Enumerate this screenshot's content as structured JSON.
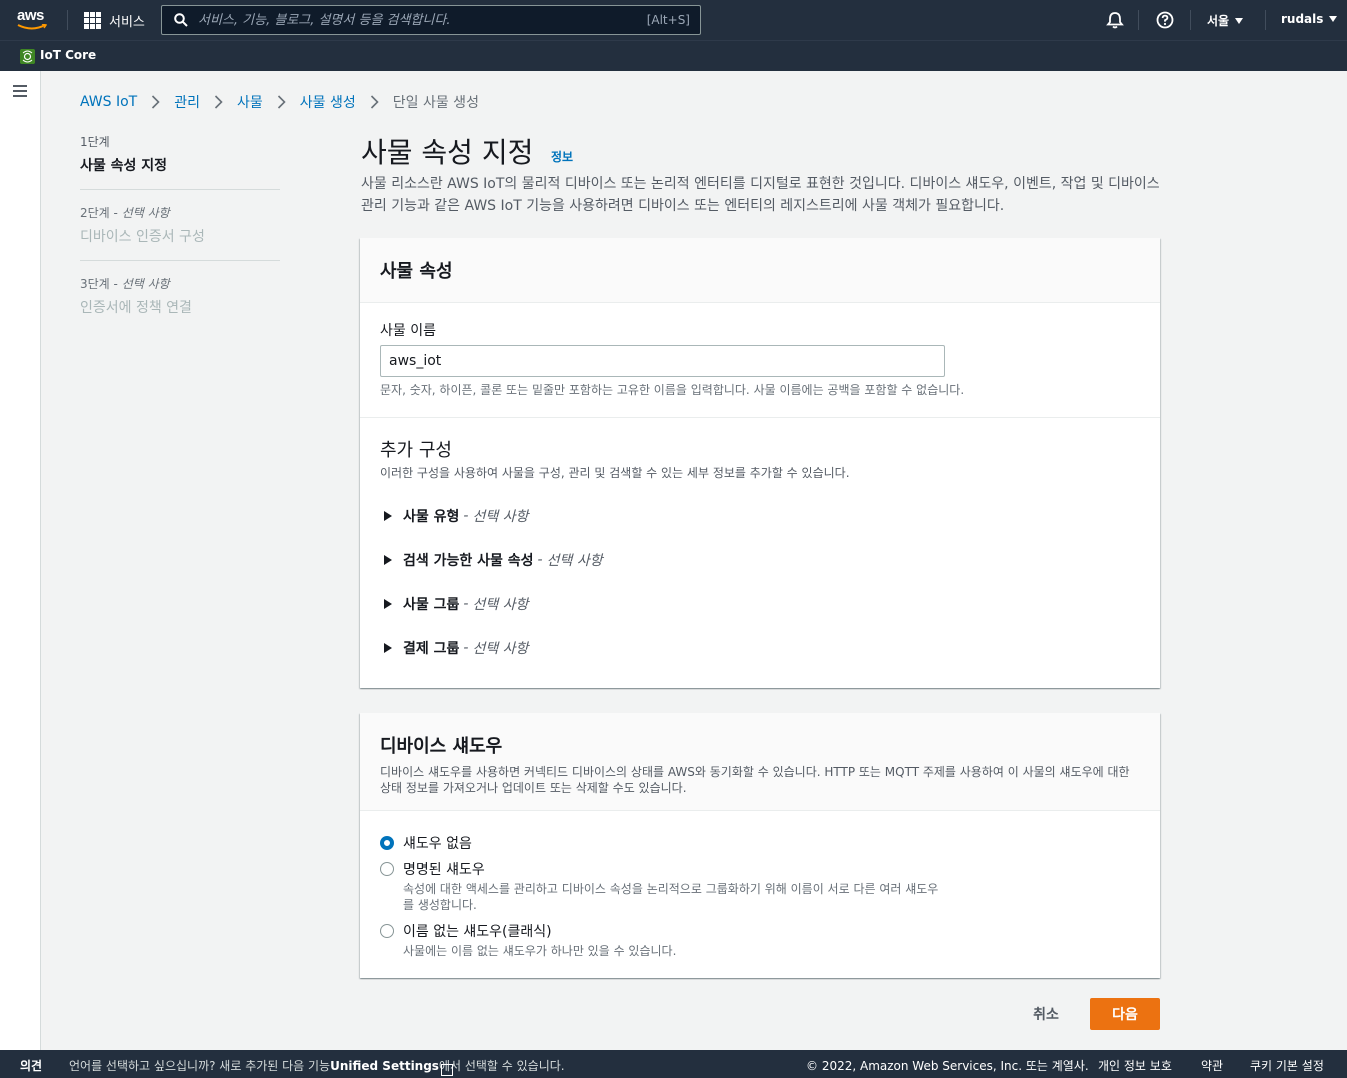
{
  "topnav": {
    "logo": "aws",
    "services_label": "서비스",
    "search_placeholder": "서비스, 기능, 블로그, 설명서 등을 검색합니다.",
    "search_shortcut": "[Alt+S]",
    "region": "서울",
    "user": "rudals"
  },
  "servicebar": {
    "name": "IoT Core"
  },
  "breadcrumb": [
    "AWS IoT",
    "관리",
    "사물",
    "사물 생성",
    "단일 사물 생성"
  ],
  "steps": [
    {
      "num": "1단계",
      "optional": "",
      "title": "사물 속성 지정",
      "state": "active"
    },
    {
      "num": "2단계",
      "optional": "선택 사항",
      "title": "디바이스 인증서 구성",
      "state": "disabled"
    },
    {
      "num": "3단계",
      "optional": "선택 사항",
      "title": "인증서에 정책 연결",
      "state": "disabled"
    }
  ],
  "page": {
    "title": "사물 속성 지정",
    "info": "정보",
    "description": "사물 리소스란 AWS IoT의 물리적 디바이스 또는 논리적 엔터티를 디지털로 표현한 것입니다. 디바이스 섀도우, 이벤트, 작업 및 디바이스 관리 기능과 같은 AWS IoT 기능을 사용하려면 디바이스 또는 엔터티의 레지스트리에 사물 객체가 필요합니다."
  },
  "thing_props": {
    "header": "사물 속성",
    "name_label": "사물 이름",
    "name_value": "aws_iot",
    "name_hint": "문자, 숫자, 하이픈, 콜론 또는 밑줄만 포함하는 고유한 이름을 입력합니다. 사물 이름에는 공백을 포함할 수 없습니다.",
    "extra_title": "추가 구성",
    "extra_desc": "이러한 구성을 사용하여 사물을 구성, 관리 및 검색할 수 있는 세부 정보를 추가할 수 있습니다.",
    "expanders": [
      {
        "label": "사물 유형",
        "sep": "-",
        "optional": "선택 사항"
      },
      {
        "label": "검색 가능한 사물 속성",
        "sep": "-",
        "optional": "선택 사항"
      },
      {
        "label": "사물 그룹",
        "sep": "-",
        "optional": "선택 사항"
      },
      {
        "label": "결제 그룹",
        "sep": "-",
        "optional": "선택 사항"
      }
    ]
  },
  "shadow": {
    "header": "디바이스 섀도우",
    "desc": "디바이스 섀도우를 사용하면 커넥티드 디바이스의 상태를 AWS와 동기화할 수 있습니다. HTTP 또는 MQTT 주제를 사용하여 이 사물의 섀도우에 대한 상태 정보를 가져오거나 업데이트 또는 삭제할 수도 있습니다.",
    "options": [
      {
        "label": "섀도우 없음",
        "desc": "",
        "checked": true
      },
      {
        "label": "명명된 섀도우",
        "desc": "속성에 대한 액세스를 관리하고 디바이스 속성을 논리적으로 그룹화하기 위해 이름이 서로 다른 여러 섀도우를 생성합니다.",
        "checked": false
      },
      {
        "label": "이름 없는 섀도우(클래식)",
        "desc": "사물에는 이름 없는 섀도우가 하나만 있을 수 있습니다.",
        "checked": false
      }
    ]
  },
  "actions": {
    "cancel": "취소",
    "next": "다음"
  },
  "footer": {
    "feedback": "의견",
    "lang_prefix": "언어를 선택하고 싶으십니까? 새로 추가된 다음 기능",
    "lang_link": "Unified Settings",
    "lang_suffix": "에서 선택할 수 있습니다.",
    "copyright": "© 2022, Amazon Web Services, Inc. 또는 계열사.",
    "privacy": "개인 정보 보호",
    "terms": "약관",
    "cookies": "쿠키 기본 설정"
  },
  "colors": {
    "nav": "#232f3e",
    "link": "#0073bb",
    "primary": "#ec7211",
    "background": "#f2f3f3"
  }
}
